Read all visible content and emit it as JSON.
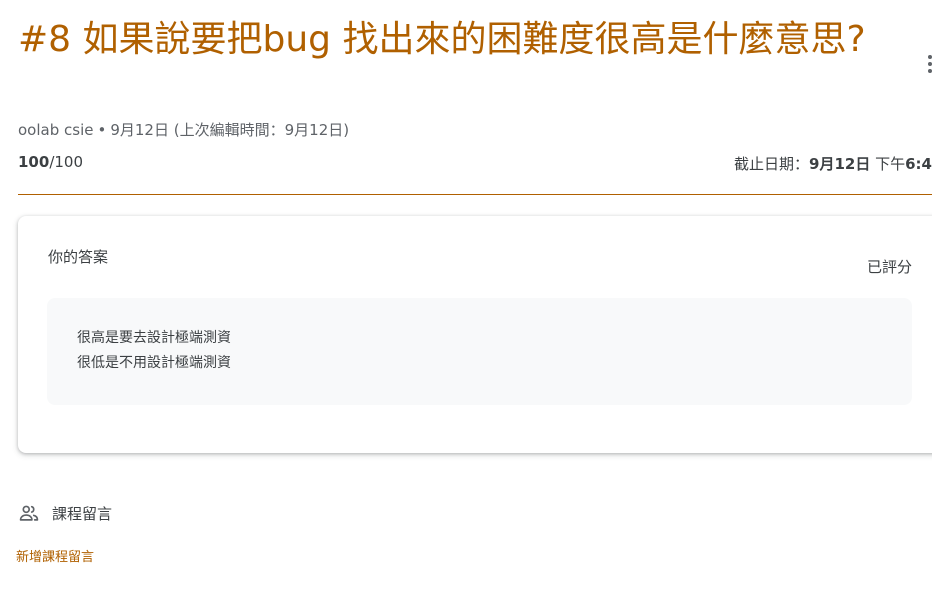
{
  "assignment": {
    "title": "#8 如果說要把bug 找出來的困難度很高是什麼意思?",
    "author": "oolab csie",
    "date_posted": "9月12日",
    "edited": "(上次編輯時間：9月12日)",
    "points_earned": "100",
    "points_total": "/100",
    "due_prefix": "截止日期：",
    "due_bold_date": "9月12日",
    "due_mid": " 下午",
    "due_bold_time": "6:4"
  },
  "answer": {
    "label": "你的答案",
    "status": "已評分",
    "text": "很高是要去設計極端測資\n很低是不用設計極端測資"
  },
  "comments": {
    "header": "課程留言",
    "add_label": "新增課程留言"
  },
  "icons": {
    "more": "more-vert-icon",
    "people": "people-icon"
  },
  "colors": {
    "accent": "#b06000",
    "text": "#3c4043",
    "secondary": "#5f6368",
    "answer_bg": "#f8f9fa"
  }
}
